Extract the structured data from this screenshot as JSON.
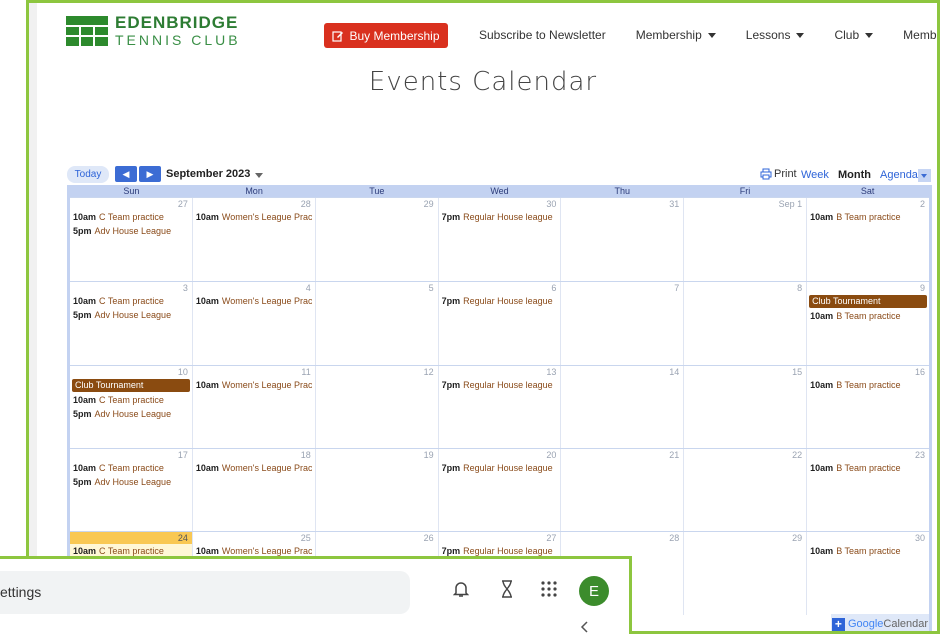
{
  "site": {
    "logo_line1": "EDENBRIDGE",
    "logo_line2": "TENNIS CLUB",
    "buy_button": "Buy Membership",
    "menu": [
      {
        "label": "Subscribe to Newsletter",
        "dropdown": false
      },
      {
        "label": "Membership",
        "dropdown": true
      },
      {
        "label": "Lessons",
        "dropdown": true
      },
      {
        "label": "Club",
        "dropdown": true
      },
      {
        "label": "Members",
        "dropdown": false
      }
    ],
    "page_title": "Events Calendar"
  },
  "calendar": {
    "today_button": "Today",
    "month_label": "September 2023",
    "print_label": "Print",
    "views": [
      "Week",
      "Month",
      "Agenda"
    ],
    "active_view": "Month",
    "day_headers": [
      "Sun",
      "Mon",
      "Tue",
      "Wed",
      "Thu",
      "Fri",
      "Sat"
    ],
    "weeks": [
      {
        "days": [
          {
            "num": "27",
            "events": [
              {
                "time": "10am",
                "title": "C Team practice"
              },
              {
                "time": "5pm",
                "title": "Adv House League"
              }
            ]
          },
          {
            "num": "28",
            "events": [
              {
                "time": "10am",
                "title": "Women's League Prac"
              }
            ]
          },
          {
            "num": "29",
            "events": []
          },
          {
            "num": "30",
            "events": [
              {
                "time": "7pm",
                "title": "Regular House league"
              }
            ]
          },
          {
            "num": "31",
            "events": []
          },
          {
            "num": "Sep 1",
            "events": []
          },
          {
            "num": "2",
            "events": [
              {
                "time": "10am",
                "title": "B Team practice"
              }
            ]
          }
        ]
      },
      {
        "days": [
          {
            "num": "3",
            "events": [
              {
                "time": "10am",
                "title": "C Team practice"
              },
              {
                "time": "5pm",
                "title": "Adv House League"
              }
            ]
          },
          {
            "num": "4",
            "events": [
              {
                "time": "10am",
                "title": "Women's League Prac"
              }
            ]
          },
          {
            "num": "5",
            "events": []
          },
          {
            "num": "6",
            "events": [
              {
                "time": "7pm",
                "title": "Regular House league"
              }
            ]
          },
          {
            "num": "7",
            "events": []
          },
          {
            "num": "8",
            "events": []
          },
          {
            "num": "9",
            "allday": "Club Tournament",
            "events": [
              {
                "time": "10am",
                "title": "B Team practice"
              }
            ]
          }
        ]
      },
      {
        "days": [
          {
            "num": "10",
            "allday": "Club Tournament",
            "events": [
              {
                "time": "10am",
                "title": "C Team practice"
              },
              {
                "time": "5pm",
                "title": "Adv House League"
              }
            ]
          },
          {
            "num": "11",
            "events": [
              {
                "time": "10am",
                "title": "Women's League Prac"
              }
            ]
          },
          {
            "num": "12",
            "events": []
          },
          {
            "num": "13",
            "events": [
              {
                "time": "7pm",
                "title": "Regular House league"
              }
            ]
          },
          {
            "num": "14",
            "events": []
          },
          {
            "num": "15",
            "events": []
          },
          {
            "num": "16",
            "events": [
              {
                "time": "10am",
                "title": "B Team practice"
              }
            ]
          }
        ]
      },
      {
        "days": [
          {
            "num": "17",
            "events": [
              {
                "time": "10am",
                "title": "C Team practice"
              },
              {
                "time": "5pm",
                "title": "Adv House League"
              }
            ]
          },
          {
            "num": "18",
            "events": [
              {
                "time": "10am",
                "title": "Women's League Prac"
              }
            ]
          },
          {
            "num": "19",
            "events": []
          },
          {
            "num": "20",
            "events": [
              {
                "time": "7pm",
                "title": "Regular House league"
              }
            ]
          },
          {
            "num": "21",
            "events": []
          },
          {
            "num": "22",
            "events": []
          },
          {
            "num": "23",
            "events": [
              {
                "time": "10am",
                "title": "B Team practice"
              }
            ]
          }
        ]
      },
      {
        "days": [
          {
            "num": "24",
            "today": true,
            "events": [
              {
                "time": "10am",
                "title": "C Team practice"
              }
            ]
          },
          {
            "num": "25",
            "events": [
              {
                "time": "10am",
                "title": "Women's League Prac"
              }
            ]
          },
          {
            "num": "26",
            "events": []
          },
          {
            "num": "27",
            "events": [
              {
                "time": "7pm",
                "title": "Regular House league"
              }
            ]
          },
          {
            "num": "28",
            "events": []
          },
          {
            "num": "29",
            "events": []
          },
          {
            "num": "30",
            "events": [
              {
                "time": "10am",
                "title": "B Team practice"
              }
            ]
          }
        ]
      }
    ],
    "google_badge": "Google",
    "google_badge_suffix": "Calendar"
  },
  "overlay": {
    "search_text": "ettings",
    "avatar_letter": "E",
    "icons": [
      "bell-icon",
      "hourglass-icon",
      "apps-grid-icon"
    ]
  },
  "colors": {
    "frame_border": "#8dc63f",
    "brand_green": "#2d7c33",
    "buy_red": "#d9301e",
    "event_text": "#8a4b1a",
    "allday_bar": "#8a4b10",
    "today_highlight": "#f9c853"
  }
}
